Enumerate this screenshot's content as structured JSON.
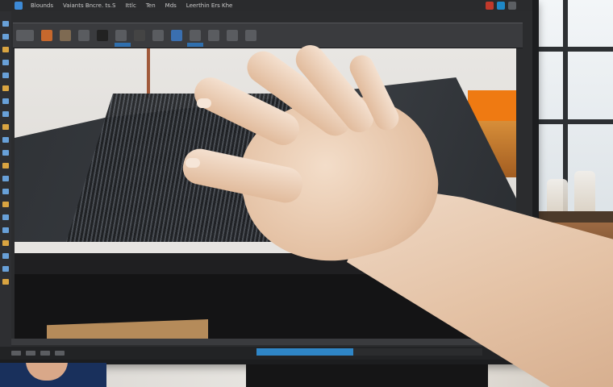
{
  "window": {
    "menus": [
      "Blounds",
      "Vaiants Bncre. ts.S",
      "Ittlc",
      "Ten",
      "Mds",
      "Leerthin Ers Khe"
    ]
  },
  "toolbar": {
    "tools": [
      "brush-tool",
      "palette-tool",
      "pen-tool",
      "lasso-tool",
      "blur-tool",
      "stamp-tool",
      "eraser-tool",
      "dodge-tool",
      "text-tool",
      "shape-tool"
    ]
  },
  "timeline": {
    "progress_fraction": 0.43
  },
  "colors": {
    "accent": "#2f86c7",
    "ui_dark": "#2b2c2e"
  }
}
